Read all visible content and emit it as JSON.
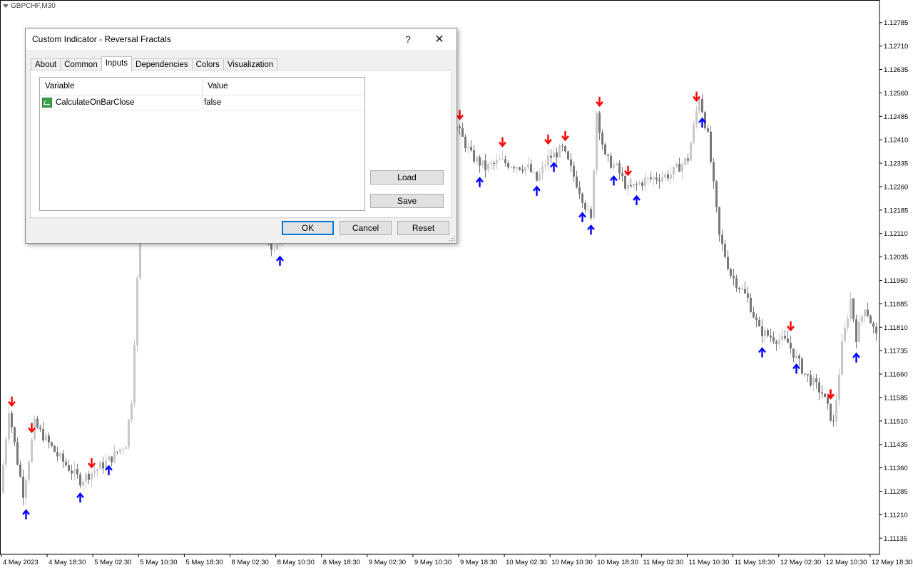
{
  "chart": {
    "symbol": "GBPCHF,M30",
    "ylim": [
      1.1109,
      1.1283
    ],
    "price_ticks": [
      "1.12785",
      "1.12710",
      "1.12635",
      "1.12560",
      "1.12485",
      "1.12410",
      "1.12335",
      "1.12260",
      "1.12185",
      "1.12110",
      "1.12035",
      "1.11960",
      "1.11885",
      "1.11810",
      "1.11735",
      "1.11660",
      "1.11585",
      "1.11510",
      "1.11435",
      "1.11360",
      "1.11285",
      "1.11210",
      "1.11135"
    ],
    "time_ticks": [
      "4 May 2023",
      "4 May 18:30",
      "5 May 02:30",
      "5 May 10:30",
      "5 May 18:30",
      "8 May 02:30",
      "8 May 10:30",
      "8 May 18:30",
      "9 May 02:30",
      "9 May 10:30",
      "9 May 18:30",
      "10 May 02:30",
      "10 May 10:30",
      "10 May 18:30",
      "11 May 02:30",
      "11 May 10:30",
      "11 May 18:30",
      "12 May 02:30",
      "12 May 10:30",
      "12 May 18:30"
    ],
    "colors": {
      "bull": "#c8c8c8",
      "bear": "#787878",
      "up_arrow": "#0000ff",
      "down_arrow": "#ff0000",
      "axis": "#000000"
    },
    "fractals_down_bar": [
      3,
      10,
      31,
      160,
      175,
      191,
      197,
      209,
      219,
      243,
      276,
      290,
      308,
      310,
      290,
      311
    ],
    "fractals_up_bar": [
      8,
      27,
      37,
      97,
      167,
      187,
      193,
      203,
      206,
      214,
      222,
      245,
      266,
      278,
      299
    ]
  },
  "dialog": {
    "title": "Custom Indicator - Reversal Fractals",
    "help": "?",
    "close": "✕",
    "tabs": [
      "About",
      "Common",
      "Inputs",
      "Dependencies",
      "Colors",
      "Visualization"
    ],
    "active_tab": "Inputs",
    "grid": {
      "headers": {
        "variable": "Variable",
        "value": "Value"
      },
      "rows": [
        {
          "variable": "CalculateOnBarClose",
          "value": "false"
        }
      ]
    },
    "buttons": {
      "load": "Load",
      "save": "Save",
      "ok": "OK",
      "cancel": "Cancel",
      "reset": "Reset"
    }
  }
}
